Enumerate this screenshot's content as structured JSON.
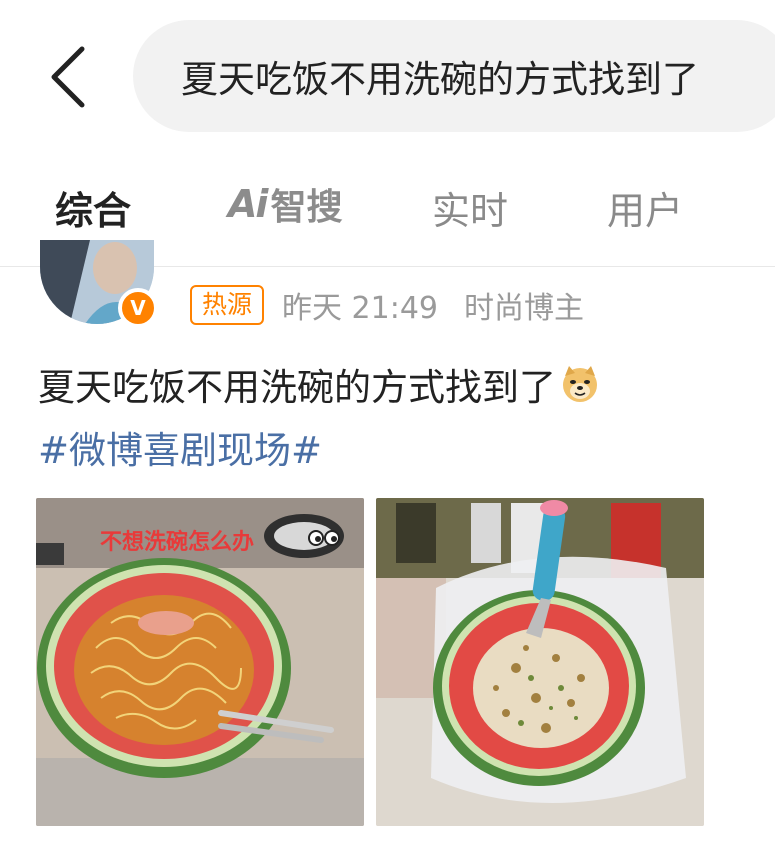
{
  "header": {
    "back_icon": "chevron-left-icon",
    "search_query": "夏天吃饭不用洗碗的方式找到了"
  },
  "tabs": [
    {
      "label": "综合",
      "active": true
    },
    {
      "label": "智搜",
      "prefix": "Ai",
      "active": false
    },
    {
      "label": "实时",
      "active": false
    },
    {
      "label": "用户",
      "active": false
    }
  ],
  "accent_color": "#ff8200",
  "post": {
    "badge": "热源",
    "time": "昨天 21:49",
    "source": "时尚博主",
    "verified_icon": "verified-v-icon",
    "text": "夏天吃饭不用洗碗的方式找到了",
    "emoji": "doge-emoji-icon",
    "hashtag": "#微博喜剧现场#",
    "images": [
      {
        "overlay_text": "不想洗碗怎么办",
        "content": "watermelon-bowl-noodles"
      },
      {
        "content": "watermelon-bowl-rice"
      }
    ]
  }
}
